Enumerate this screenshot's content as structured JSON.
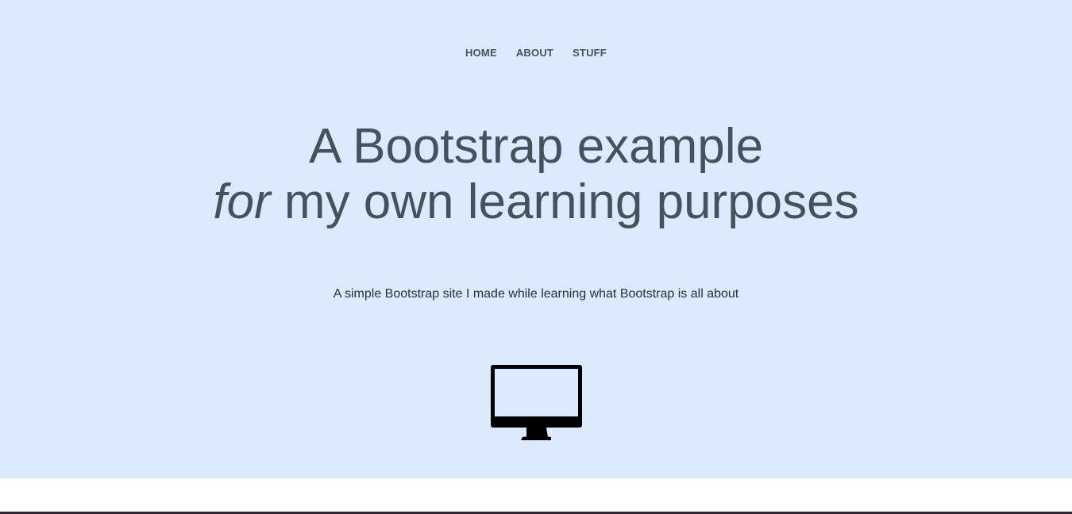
{
  "nav": {
    "items": [
      {
        "label": "HOME"
      },
      {
        "label": "ABOUT"
      },
      {
        "label": "STUFF"
      }
    ]
  },
  "hero": {
    "headline_line1": "A Bootstrap example",
    "headline_line2_em": "for",
    "headline_line2_rest": " my own learning purposes",
    "subtitle": "A simple Bootstrap site I made while learning what Bootstrap is all about",
    "icon": "desktop-monitor-icon"
  },
  "colors": {
    "hero_background": "#dbeafe",
    "text": "#46525b",
    "page_background": "#ffffff"
  }
}
